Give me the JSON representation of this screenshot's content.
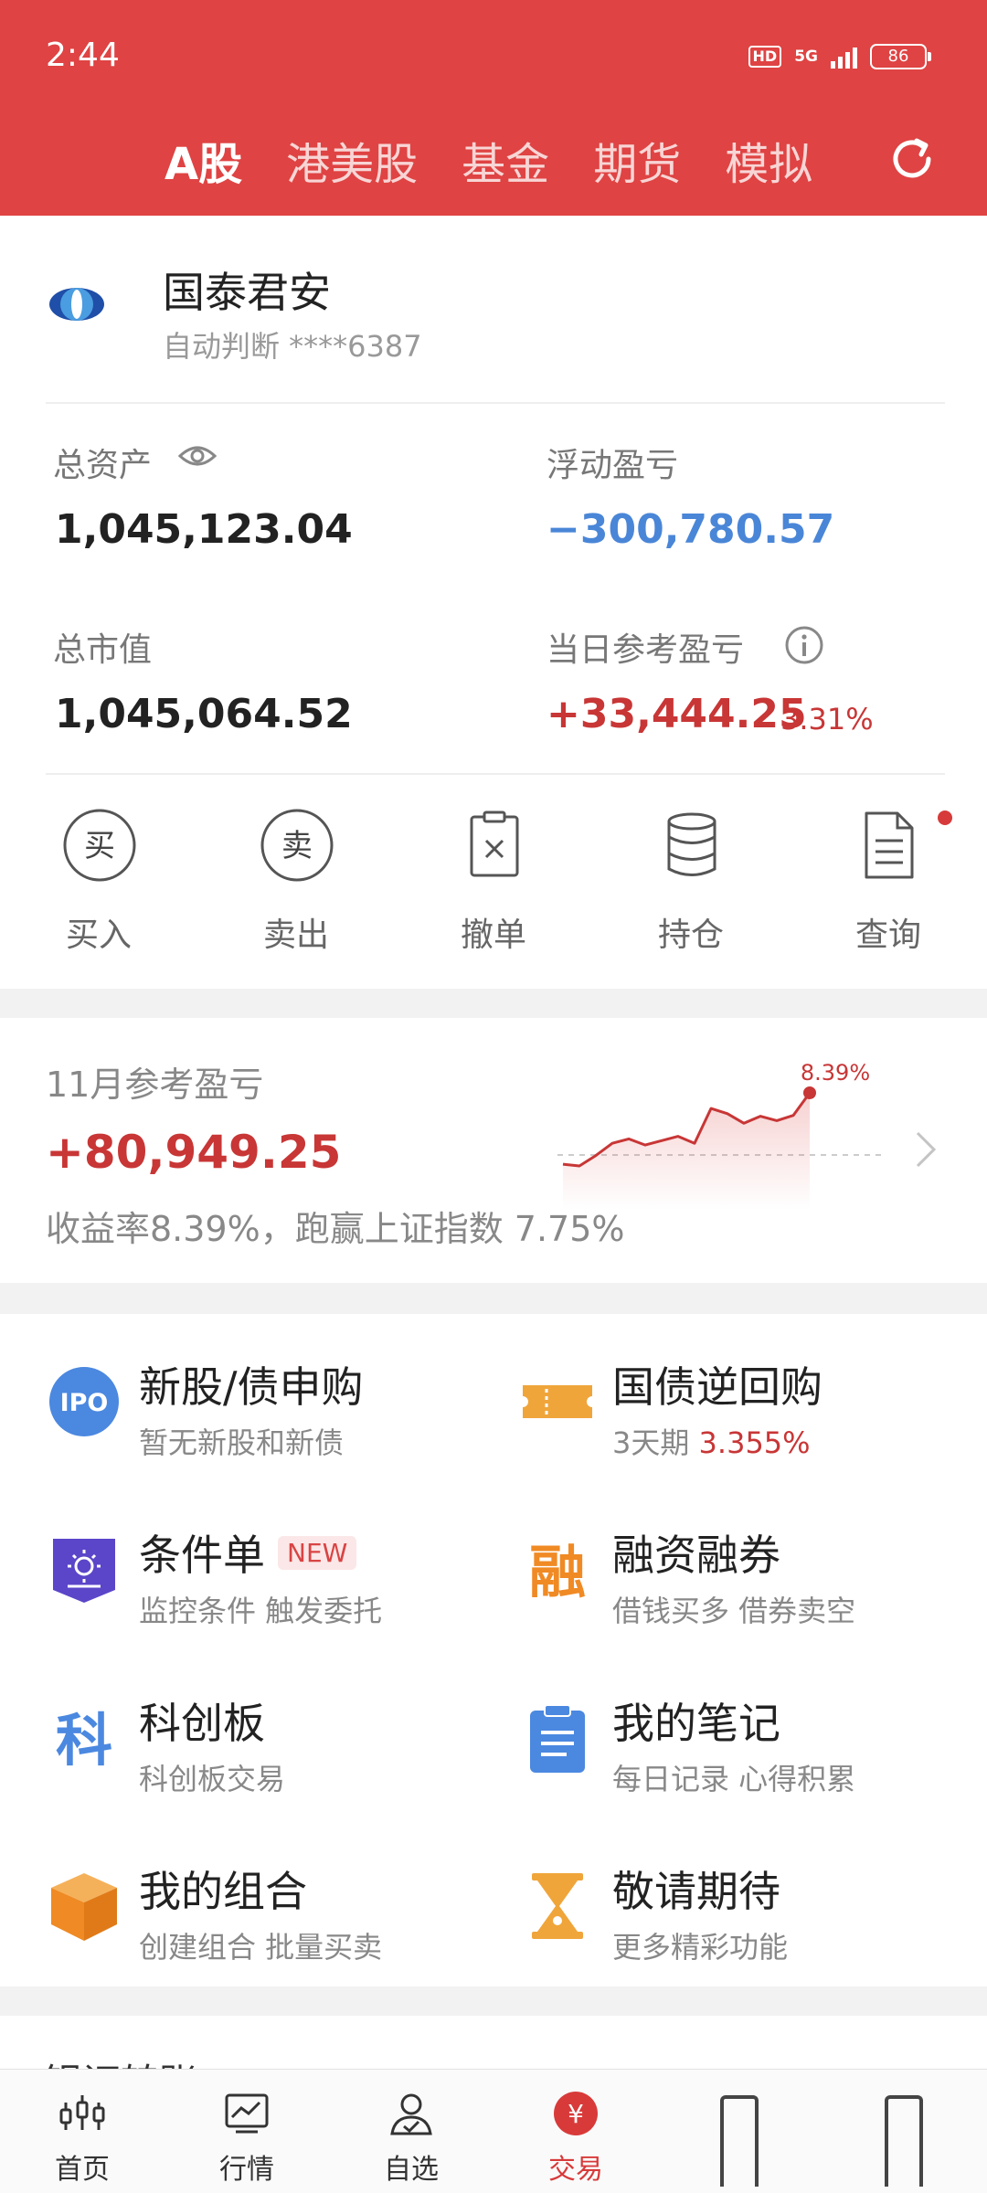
{
  "status": {
    "time": "2:44",
    "hd": "HD",
    "network": "5G",
    "battery": "86"
  },
  "market_tabs": [
    {
      "label": "A股",
      "active": true
    },
    {
      "label": "港美股",
      "active": false
    },
    {
      "label": "基金",
      "active": false
    },
    {
      "label": "期货",
      "active": false
    },
    {
      "label": "模拟",
      "active": false
    }
  ],
  "account": {
    "broker_name": "国泰君安",
    "account_sub": "自动判断 ****6387",
    "total_assets_label": "总资产",
    "total_assets": "1,045,123.04",
    "floating_pl_label": "浮动盈亏",
    "floating_pl": "−300,780.57",
    "market_value_label": "总市值",
    "market_value": "1,045,064.52",
    "daily_pl_label": "当日参考盈亏",
    "daily_pl": "+33,444.25",
    "daily_pl_pct": "3.31%"
  },
  "actions": [
    {
      "label": "买入",
      "icon": "buy-icon",
      "glyph": "买"
    },
    {
      "label": "卖出",
      "icon": "sell-icon",
      "glyph": "卖"
    },
    {
      "label": "撤单",
      "icon": "cancel-order-icon"
    },
    {
      "label": "持仓",
      "icon": "holdings-icon"
    },
    {
      "label": "查询",
      "icon": "query-document-icon"
    }
  ],
  "monthly": {
    "title": "11月参考盈亏",
    "value": "+80,949.25",
    "desc": "收益率8.39%，跑赢上证指数 7.75%",
    "chart_end_label": "8.39%",
    "trend": [
      0.2,
      0.0,
      1.2,
      2.6,
      3.1,
      2.4,
      2.9,
      3.4,
      2.6,
      6.6,
      6.0,
      4.9,
      5.7,
      5.2,
      5.8,
      8.39
    ]
  },
  "services": [
    {
      "title": "新股/债申购",
      "sub": "暂无新股和新债",
      "icon": "ipo-icon"
    },
    {
      "title": "国债逆回购",
      "sub_prefix": "3天期 ",
      "sub_highlight": "3.355%",
      "icon": "ticket-icon"
    },
    {
      "title": "条件单",
      "badge": "NEW",
      "sub": "监控条件 触发委托",
      "icon": "condition-order-icon"
    },
    {
      "title": "融资融券",
      "sub": "借钱买多 借券卖空",
      "icon": "margin-trading-icon",
      "glyph": "融"
    },
    {
      "title": "科创板",
      "sub": "科创板交易",
      "icon": "star-market-icon",
      "glyph": "科"
    },
    {
      "title": "我的笔记",
      "sub": "每日记录 心得积累",
      "icon": "notes-clipboard-icon"
    },
    {
      "title": "我的组合",
      "sub": "创建组合 批量买卖",
      "icon": "portfolio-box-icon"
    },
    {
      "title": "敬请期待",
      "sub": "更多精彩功能",
      "icon": "hourglass-icon"
    }
  ],
  "bottom_peek_text": "银证转账",
  "nav": [
    {
      "label": "首页",
      "icon": "home-candlestick-icon"
    },
    {
      "label": "行情",
      "icon": "market-chart-icon"
    },
    {
      "label": "自选",
      "icon": "watchlist-person-icon"
    },
    {
      "label": "交易",
      "icon": "trade-yuan-icon",
      "glyph": "¥",
      "active": true
    }
  ],
  "colors": {
    "brand_red": "#df4343",
    "profit_red": "#c83636",
    "loss_blue": "#4a86d7"
  }
}
